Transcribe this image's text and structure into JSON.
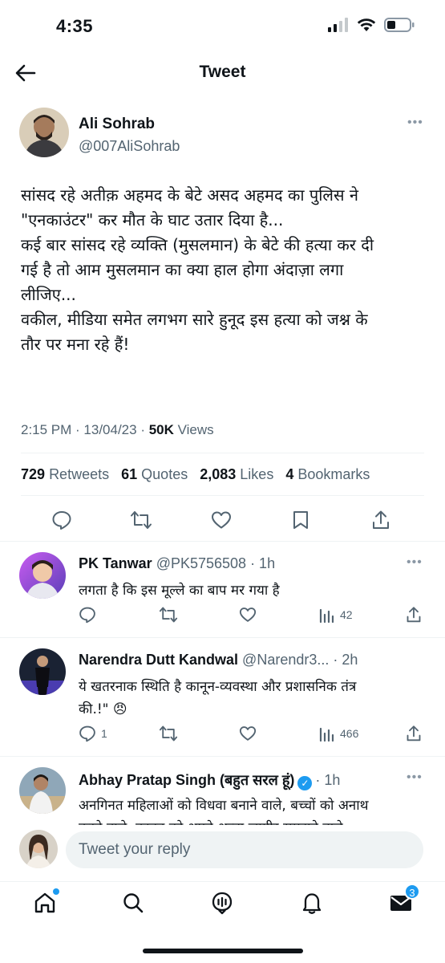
{
  "status_bar": {
    "time": "4:35"
  },
  "header": {
    "title": "Tweet"
  },
  "tweet": {
    "author_name": "Ali Sohrab",
    "author_handle": "@007AliSohrab",
    "text_lines": [
      "सांसद रहे अतीक़ अहमद के बेटे असद अहमद का पुलिस ने",
      "\"एनकाउंटर\" कर मौत के घाट उतार दिया है...",
      "कई बार सांसद रहे व्यक्ति (मुसलमान) के बेटे की हत्या कर दी",
      "गई है तो आम मुसलमान का क्या हाल होगा अंदाज़ा लगा",
      "लीजिए...",
      "वकील, मीडिया समेत लगभग सारे हुनूद इस हत्या को जश्न के",
      "तौर पर मना रहे हैं!"
    ],
    "timestamp": "2:15 PM · 13/04/23 · ",
    "views_count": "50K",
    "views_label": " Views",
    "stats": {
      "retweets": "729",
      "retweets_label": "Retweets",
      "quotes": "61",
      "quotes_label": "Quotes",
      "likes": "2,083",
      "likes_label": "Likes",
      "bookmarks": "4",
      "bookmarks_label": "Bookmarks"
    }
  },
  "replies": [
    {
      "name": "PK Tanwar",
      "handle": "@PK5756508 · 1h",
      "lines": [
        "लगता है कि इस मूल्ले का बाप मर गया है"
      ],
      "reply_count": "",
      "views": "42"
    },
    {
      "name": "Narendra Dutt Kandwal",
      "handle": "@Narendr3... · 2h",
      "lines": [
        "ये खतरनाक स्थिति है कानून-व्यवस्था और प्रशासनिक तंत्र",
        "की.!\" 😠"
      ],
      "reply_count": "1",
      "views": "466"
    },
    {
      "name": "Abhay Pratap Singh (बहुत सरल हूं)",
      "handle": "· 1h",
      "lines": [
        "अनगिनत महिलाओं को विधवा बनाने वाले, बच्चों को अनाथ",
        "करने वाले, कानून को अपने अब्बा जागीर समझने वाले"
      ]
    }
  ],
  "reply_bar": {
    "placeholder": "Tweet your reply"
  },
  "tab_bar": {
    "messages_badge": "3"
  },
  "colors": {
    "accent": "#1d9bf0",
    "text": "#0f1419",
    "secondary": "#536471",
    "divider": "#eff3f4"
  }
}
